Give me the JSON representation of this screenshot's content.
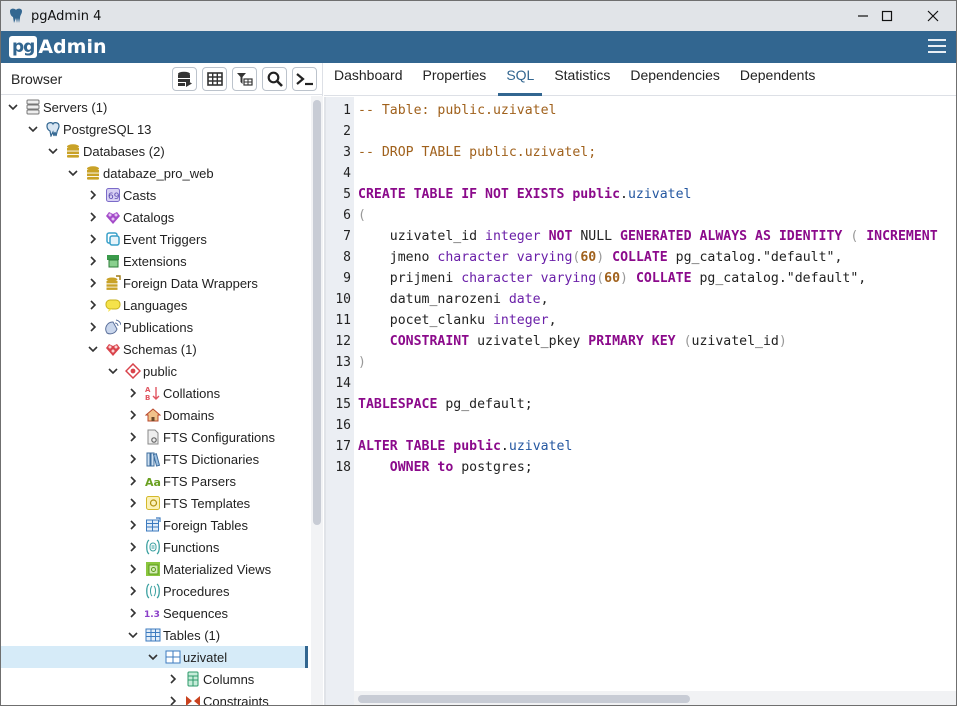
{
  "window": {
    "title": "pgAdmin 4",
    "controls": {
      "minimize": "minimize",
      "maximize": "maximize",
      "close": "close"
    }
  },
  "brand": {
    "logo_pg": "pg",
    "logo_admin": "Admin"
  },
  "browser": {
    "label": "Browser",
    "toolbar": [
      {
        "name": "query-tool-button",
        "icon": "database-play-icon"
      },
      {
        "name": "view-data-button",
        "icon": "table-grid-icon"
      },
      {
        "name": "filtered-rows-button",
        "icon": "filter-table-icon"
      },
      {
        "name": "search-objects-button",
        "icon": "search-icon"
      },
      {
        "name": "psql-tool-button",
        "icon": "terminal-icon"
      }
    ],
    "tree": [
      {
        "label": "Servers (1)",
        "level": 0,
        "expanded": true,
        "icon": "servers-icon"
      },
      {
        "label": "PostgreSQL 13",
        "level": 1,
        "expanded": true,
        "icon": "elephant-icon"
      },
      {
        "label": "Databases (2)",
        "level": 2,
        "expanded": true,
        "icon": "databases-icon"
      },
      {
        "label": "databaze_pro_web",
        "level": 3,
        "expanded": true,
        "icon": "database-icon"
      },
      {
        "label": "Casts",
        "level": 4,
        "expanded": false,
        "icon": "casts-icon"
      },
      {
        "label": "Catalogs",
        "level": 4,
        "expanded": false,
        "icon": "catalogs-icon"
      },
      {
        "label": "Event Triggers",
        "level": 4,
        "expanded": false,
        "icon": "event-triggers-icon"
      },
      {
        "label": "Extensions",
        "level": 4,
        "expanded": false,
        "icon": "extensions-icon"
      },
      {
        "label": "Foreign Data Wrappers",
        "level": 4,
        "expanded": false,
        "icon": "foreign-data-wrappers-icon"
      },
      {
        "label": "Languages",
        "level": 4,
        "expanded": false,
        "icon": "languages-icon"
      },
      {
        "label": "Publications",
        "level": 4,
        "expanded": false,
        "icon": "publications-icon"
      },
      {
        "label": "Schemas (1)",
        "level": 4,
        "expanded": true,
        "icon": "schemas-icon"
      },
      {
        "label": "public",
        "level": 5,
        "expanded": true,
        "icon": "schema-icon"
      },
      {
        "label": "Collations",
        "level": 6,
        "expanded": false,
        "icon": "collations-icon"
      },
      {
        "label": "Domains",
        "level": 6,
        "expanded": false,
        "icon": "domains-icon"
      },
      {
        "label": "FTS Configurations",
        "level": 6,
        "expanded": false,
        "icon": "fts-configurations-icon"
      },
      {
        "label": "FTS Dictionaries",
        "level": 6,
        "expanded": false,
        "icon": "fts-dictionaries-icon"
      },
      {
        "label": "FTS Parsers",
        "level": 6,
        "expanded": false,
        "icon": "fts-parsers-icon"
      },
      {
        "label": "FTS Templates",
        "level": 6,
        "expanded": false,
        "icon": "fts-templates-icon"
      },
      {
        "label": "Foreign Tables",
        "level": 6,
        "expanded": false,
        "icon": "foreign-tables-icon"
      },
      {
        "label": "Functions",
        "level": 6,
        "expanded": false,
        "icon": "functions-icon"
      },
      {
        "label": "Materialized Views",
        "level": 6,
        "expanded": false,
        "icon": "materialized-views-icon"
      },
      {
        "label": "Procedures",
        "level": 6,
        "expanded": false,
        "icon": "procedures-icon"
      },
      {
        "label": "Sequences",
        "level": 6,
        "expanded": false,
        "icon": "sequences-icon"
      },
      {
        "label": "Tables (1)",
        "level": 6,
        "expanded": true,
        "icon": "tables-icon"
      },
      {
        "label": "uzivatel",
        "level": 7,
        "expanded": true,
        "icon": "table-icon",
        "selected": true
      },
      {
        "label": "Columns",
        "level": 8,
        "expanded": false,
        "icon": "columns-icon"
      },
      {
        "label": "Constraints",
        "level": 8,
        "expanded": false,
        "icon": "constraints-icon"
      }
    ]
  },
  "tabs": [
    {
      "label": "Dashboard",
      "active": false
    },
    {
      "label": "Properties",
      "active": false
    },
    {
      "label": "SQL",
      "active": true
    },
    {
      "label": "Statistics",
      "active": false
    },
    {
      "label": "Dependencies",
      "active": false
    },
    {
      "label": "Dependents",
      "active": false
    }
  ],
  "sql": {
    "lines": [
      [
        [
          "com",
          "-- Table: public.uzivatel"
        ]
      ],
      [],
      [
        [
          "com",
          "-- DROP TABLE public.uzivatel;"
        ]
      ],
      [],
      [
        [
          "kw",
          "CREATE TABLE IF NOT EXISTS public"
        ],
        [
          "plain",
          "."
        ],
        [
          "ident",
          "uzivatel"
        ]
      ],
      [
        [
          "paren",
          "("
        ]
      ],
      [
        [
          "plain",
          "    uzivatel_id "
        ],
        [
          "type",
          "integer"
        ],
        [
          "plain",
          " "
        ],
        [
          "kw",
          "NOT"
        ],
        [
          "plain",
          " NULL "
        ],
        [
          "kw",
          "GENERATED ALWAYS AS IDENTITY"
        ],
        [
          "plain",
          " "
        ],
        [
          "paren",
          "("
        ],
        [
          "plain",
          " "
        ],
        [
          "kw",
          "INCREMENT"
        ]
      ],
      [
        [
          "plain",
          "    jmeno "
        ],
        [
          "type",
          "character varying"
        ],
        [
          "paren",
          "("
        ],
        [
          "num",
          "60"
        ],
        [
          "paren",
          ")"
        ],
        [
          "plain",
          " "
        ],
        [
          "kw",
          "COLLATE"
        ],
        [
          "plain",
          " pg_catalog.\"default\","
        ]
      ],
      [
        [
          "plain",
          "    prijmeni "
        ],
        [
          "type",
          "character varying"
        ],
        [
          "paren",
          "("
        ],
        [
          "num",
          "60"
        ],
        [
          "paren",
          ")"
        ],
        [
          "plain",
          " "
        ],
        [
          "kw",
          "COLLATE"
        ],
        [
          "plain",
          " pg_catalog.\"default\","
        ]
      ],
      [
        [
          "plain",
          "    datum_narozeni "
        ],
        [
          "type",
          "date"
        ],
        [
          "plain",
          ","
        ]
      ],
      [
        [
          "plain",
          "    pocet_clanku "
        ],
        [
          "type",
          "integer"
        ],
        [
          "plain",
          ","
        ]
      ],
      [
        [
          "plain",
          "    "
        ],
        [
          "kw",
          "CONSTRAINT"
        ],
        [
          "plain",
          " uzivatel_pkey "
        ],
        [
          "kw",
          "PRIMARY KEY"
        ],
        [
          "plain",
          " "
        ],
        [
          "paren",
          "("
        ],
        [
          "plain",
          "uzivatel_id"
        ],
        [
          "paren",
          ")"
        ]
      ],
      [
        [
          "paren",
          ")"
        ]
      ],
      [],
      [
        [
          "kw",
          "TABLESPACE"
        ],
        [
          "plain",
          " pg_default;"
        ]
      ],
      [],
      [
        [
          "kw",
          "ALTER TABLE public"
        ],
        [
          "plain",
          "."
        ],
        [
          "ident",
          "uzivatel"
        ]
      ],
      [
        [
          "plain",
          "    "
        ],
        [
          "kw",
          "OWNER to"
        ],
        [
          "plain",
          " postgres;"
        ]
      ]
    ]
  },
  "colors": {
    "brand": "#326690",
    "selection": "#d6ebf8",
    "keyword": "#8b0a8b",
    "comment": "#a0611c",
    "type": "#6a1fa8"
  }
}
